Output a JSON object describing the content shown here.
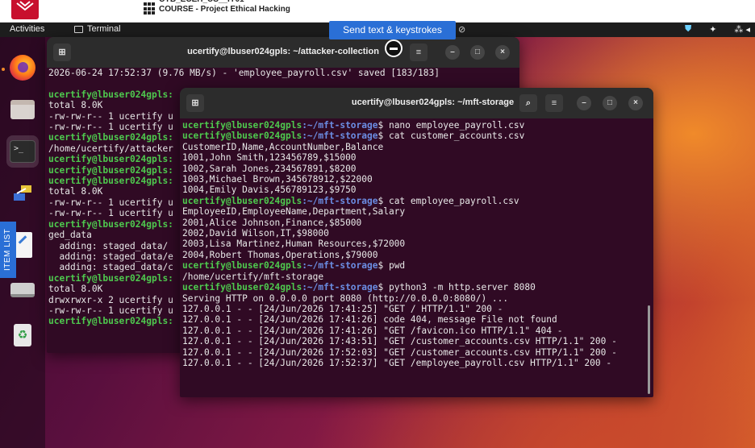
{
  "course": {
    "id": "CYB_ECEH_US__IY01",
    "title": "COURSE - Project Ethical Hacking"
  },
  "topbar": {
    "activities": "Activities",
    "app_name": "Terminal",
    "tray": [
      "⛊",
      "✦",
      "⁂ ◂"
    ]
  },
  "banner": {
    "label": "Send text & keystrokes",
    "close": "⊘"
  },
  "side_tab": {
    "label": "ITEM LIST"
  },
  "dock": {
    "items": [
      "firefox-icon",
      "files-icon",
      "terminal-icon",
      "network-icon",
      "text-editor-icon",
      "disk-icon",
      "trash-icon"
    ]
  },
  "window_a": {
    "title": "ucertify@lbuser024gpls: ~/attacker-collection",
    "menu_btn": "≡",
    "min": "–",
    "max": "□",
    "close": "×",
    "lines": [
      {
        "t": "2026-06-24 17:52:37 (9.76 MB/s) - 'employee_payroll.csv' saved [183/183]"
      },
      {
        "t": ""
      },
      {
        "u": "ucertify@lbuser024gpls:"
      },
      {
        "t": "total 8.0K"
      },
      {
        "t": "-rw-rw-r-- 1 ucertify u"
      },
      {
        "t": "-rw-rw-r-- 1 ucertify u"
      },
      {
        "u": "ucertify@lbuser024gpls:"
      },
      {
        "t": "/home/ucertify/attacker"
      },
      {
        "u": "ucertify@lbuser024gpls:"
      },
      {
        "u": "ucertify@lbuser024gpls:"
      },
      {
        "u": "ucertify@lbuser024gpls:"
      },
      {
        "t": "total 8.0K"
      },
      {
        "t": "-rw-rw-r-- 1 ucertify u"
      },
      {
        "t": "-rw-rw-r-- 1 ucertify u"
      },
      {
        "u": "ucertify@lbuser024gpls:"
      },
      {
        "t": "ged_data"
      },
      {
        "t": "  adding: staged_data/"
      },
      {
        "t": "  adding: staged_data/e"
      },
      {
        "t": "  adding: staged_data/c"
      },
      {
        "u": "ucertify@lbuser024gpls:"
      },
      {
        "t": "total 8.0K"
      },
      {
        "t": "drwxrwxr-x 2 ucertify u"
      },
      {
        "t": "-rw-rw-r-- 1 ucertify u"
      },
      {
        "u": "ucertify@lbuser024gpls:"
      }
    ]
  },
  "window_b": {
    "title": "ucertify@lbuser024gpls: ~/mft-storage",
    "search": "⌕",
    "menu_btn": "≡",
    "min": "–",
    "max": "□",
    "close": "×",
    "prompt_user": "ucertify@lbuser024gpls",
    "prompt_path": ":~/mft-storage",
    "lines": [
      {
        "cmd": "$ nano employee_payroll.csv"
      },
      {
        "cmd": "$ cat customer_accounts.csv"
      },
      {
        "t": "CustomerID,Name,AccountNumber,Balance"
      },
      {
        "t": "1001,John Smith,123456789,$15000"
      },
      {
        "t": "1002,Sarah Jones,234567891,$8200"
      },
      {
        "t": "1003,Michael Brown,345678912,$22000"
      },
      {
        "t": "1004,Emily Davis,456789123,$9750"
      },
      {
        "cmd": "$ cat employee_payroll.csv"
      },
      {
        "t": "EmployeeID,EmployeeName,Department,Salary"
      },
      {
        "t": "2001,Alice Johnson,Finance,$85000"
      },
      {
        "t": "2002,David Wilson,IT,$98000"
      },
      {
        "t": "2003,Lisa Martinez,Human Resources,$72000"
      },
      {
        "t": "2004,Robert Thomas,Operations,$79000"
      },
      {
        "cmd": "$ pwd"
      },
      {
        "t": "/home/ucertify/mft-storage"
      },
      {
        "cmd": "$ python3 -m http.server 8080"
      },
      {
        "t": "Serving HTTP on 0.0.0.0 port 8080 (http://0.0.0.0:8080/) ..."
      },
      {
        "t": "127.0.0.1 - - [24/Jun/2026 17:41:25] \"GET / HTTP/1.1\" 200 -"
      },
      {
        "t": "127.0.0.1 - - [24/Jun/2026 17:41:26] code 404, message File not found"
      },
      {
        "t": "127.0.0.1 - - [24/Jun/2026 17:41:26] \"GET /favicon.ico HTTP/1.1\" 404 -"
      },
      {
        "t": "127.0.0.1 - - [24/Jun/2026 17:43:51] \"GET /customer_accounts.csv HTTP/1.1\" 200 -"
      },
      {
        "t": "127.0.0.1 - - [24/Jun/2026 17:52:03] \"GET /customer_accounts.csv HTTP/1.1\" 200 -"
      },
      {
        "t": "127.0.0.1 - - [24/Jun/2026 17:52:37] \"GET /employee_payroll.csv HTTP/1.1\" 200 -"
      }
    ]
  }
}
